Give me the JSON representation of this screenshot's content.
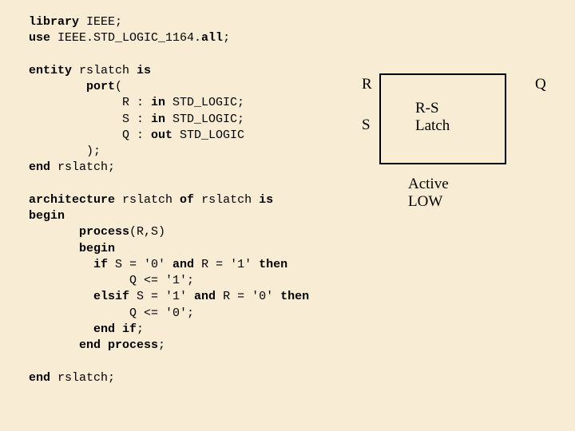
{
  "code": {
    "l1a": "library",
    "l1b": " IEEE;",
    "l2a": "use",
    "l2b": " IEEE.STD_LOGIC_1164.",
    "l2c": "all",
    "l2d": ";",
    "l3a": "entity",
    "l3b": " rslatch ",
    "l3c": "is",
    "l4a": "        port",
    "l4b": "(",
    "l5a": "             R : ",
    "l5b": "in",
    "l5c": " STD_LOGIC;",
    "l6a": "             S : ",
    "l6b": "in",
    "l6c": " STD_LOGIC;",
    "l7a": "             Q : ",
    "l7b": "out",
    "l7c": " STD_LOGIC",
    "l8a": "        );",
    "l9a": "end",
    "l9b": " rslatch;",
    "l10a": "architecture",
    "l10b": " rslatch ",
    "l10c": "of",
    "l10d": " rslatch ",
    "l10e": "is",
    "l11a": "begin",
    "l12a": "       process",
    "l12b": "(R,S)",
    "l13a": "       begin",
    "l14a": "         if",
    "l14b": " S = '0' ",
    "l14c": "and",
    "l14d": " R = '1' ",
    "l14e": "then",
    "l15a": "              Q <= '1';",
    "l16a": "         elsif",
    "l16b": " S = '1' ",
    "l16c": "and",
    "l16d": " R = '0' ",
    "l16e": "then",
    "l17a": "              Q <= '0';",
    "l18a": "         end if",
    "l18b": ";",
    "l19a": "       end process",
    "l19b": ";",
    "l20a": "end",
    "l20b": " rslatch;"
  },
  "diagram": {
    "r": "R",
    "s": "S",
    "q": "Q",
    "label": "R-S Latch",
    "caption": "Active LOW"
  }
}
